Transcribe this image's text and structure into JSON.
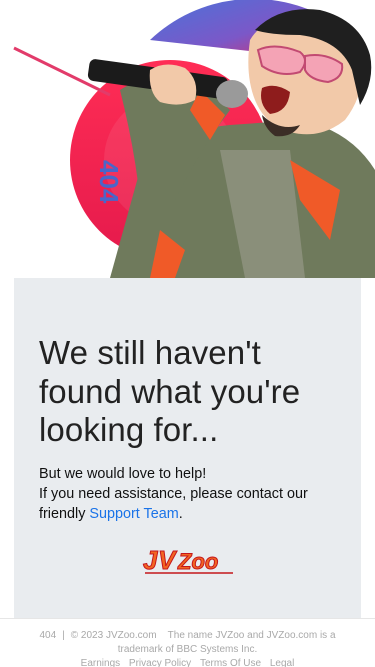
{
  "hero": {
    "badge_text": "404"
  },
  "content": {
    "headline": "We still haven't found what you're looking for...",
    "line1": "But we would love to help!",
    "line2_prefix": "If you need assistance, please contact our friendly ",
    "support_link": "Support Team",
    "line2_suffix": "."
  },
  "logo": {
    "text_j": "J",
    "text_v": "V",
    "text_zoo": "Zoo"
  },
  "footer": {
    "code": "404",
    "separator": "|",
    "copyright": "© 2023 JVZoo.com",
    "trademark": "The name JVZoo and JVZoo.com is a trademark of BBC Systems Inc.",
    "links": [
      "Earnings",
      "Privacy Policy",
      "Terms Of Use",
      "Legal"
    ]
  },
  "colors": {
    "panel_bg": "#e9ecef",
    "link": "#1a73e8",
    "logo_orange": "#f26522",
    "logo_red": "#c4161c",
    "hero_red": "#ee1f4a",
    "hero_blue": "#3f6fd8",
    "jacket": "#6f7a5c",
    "jacket_accent": "#f05a28"
  }
}
